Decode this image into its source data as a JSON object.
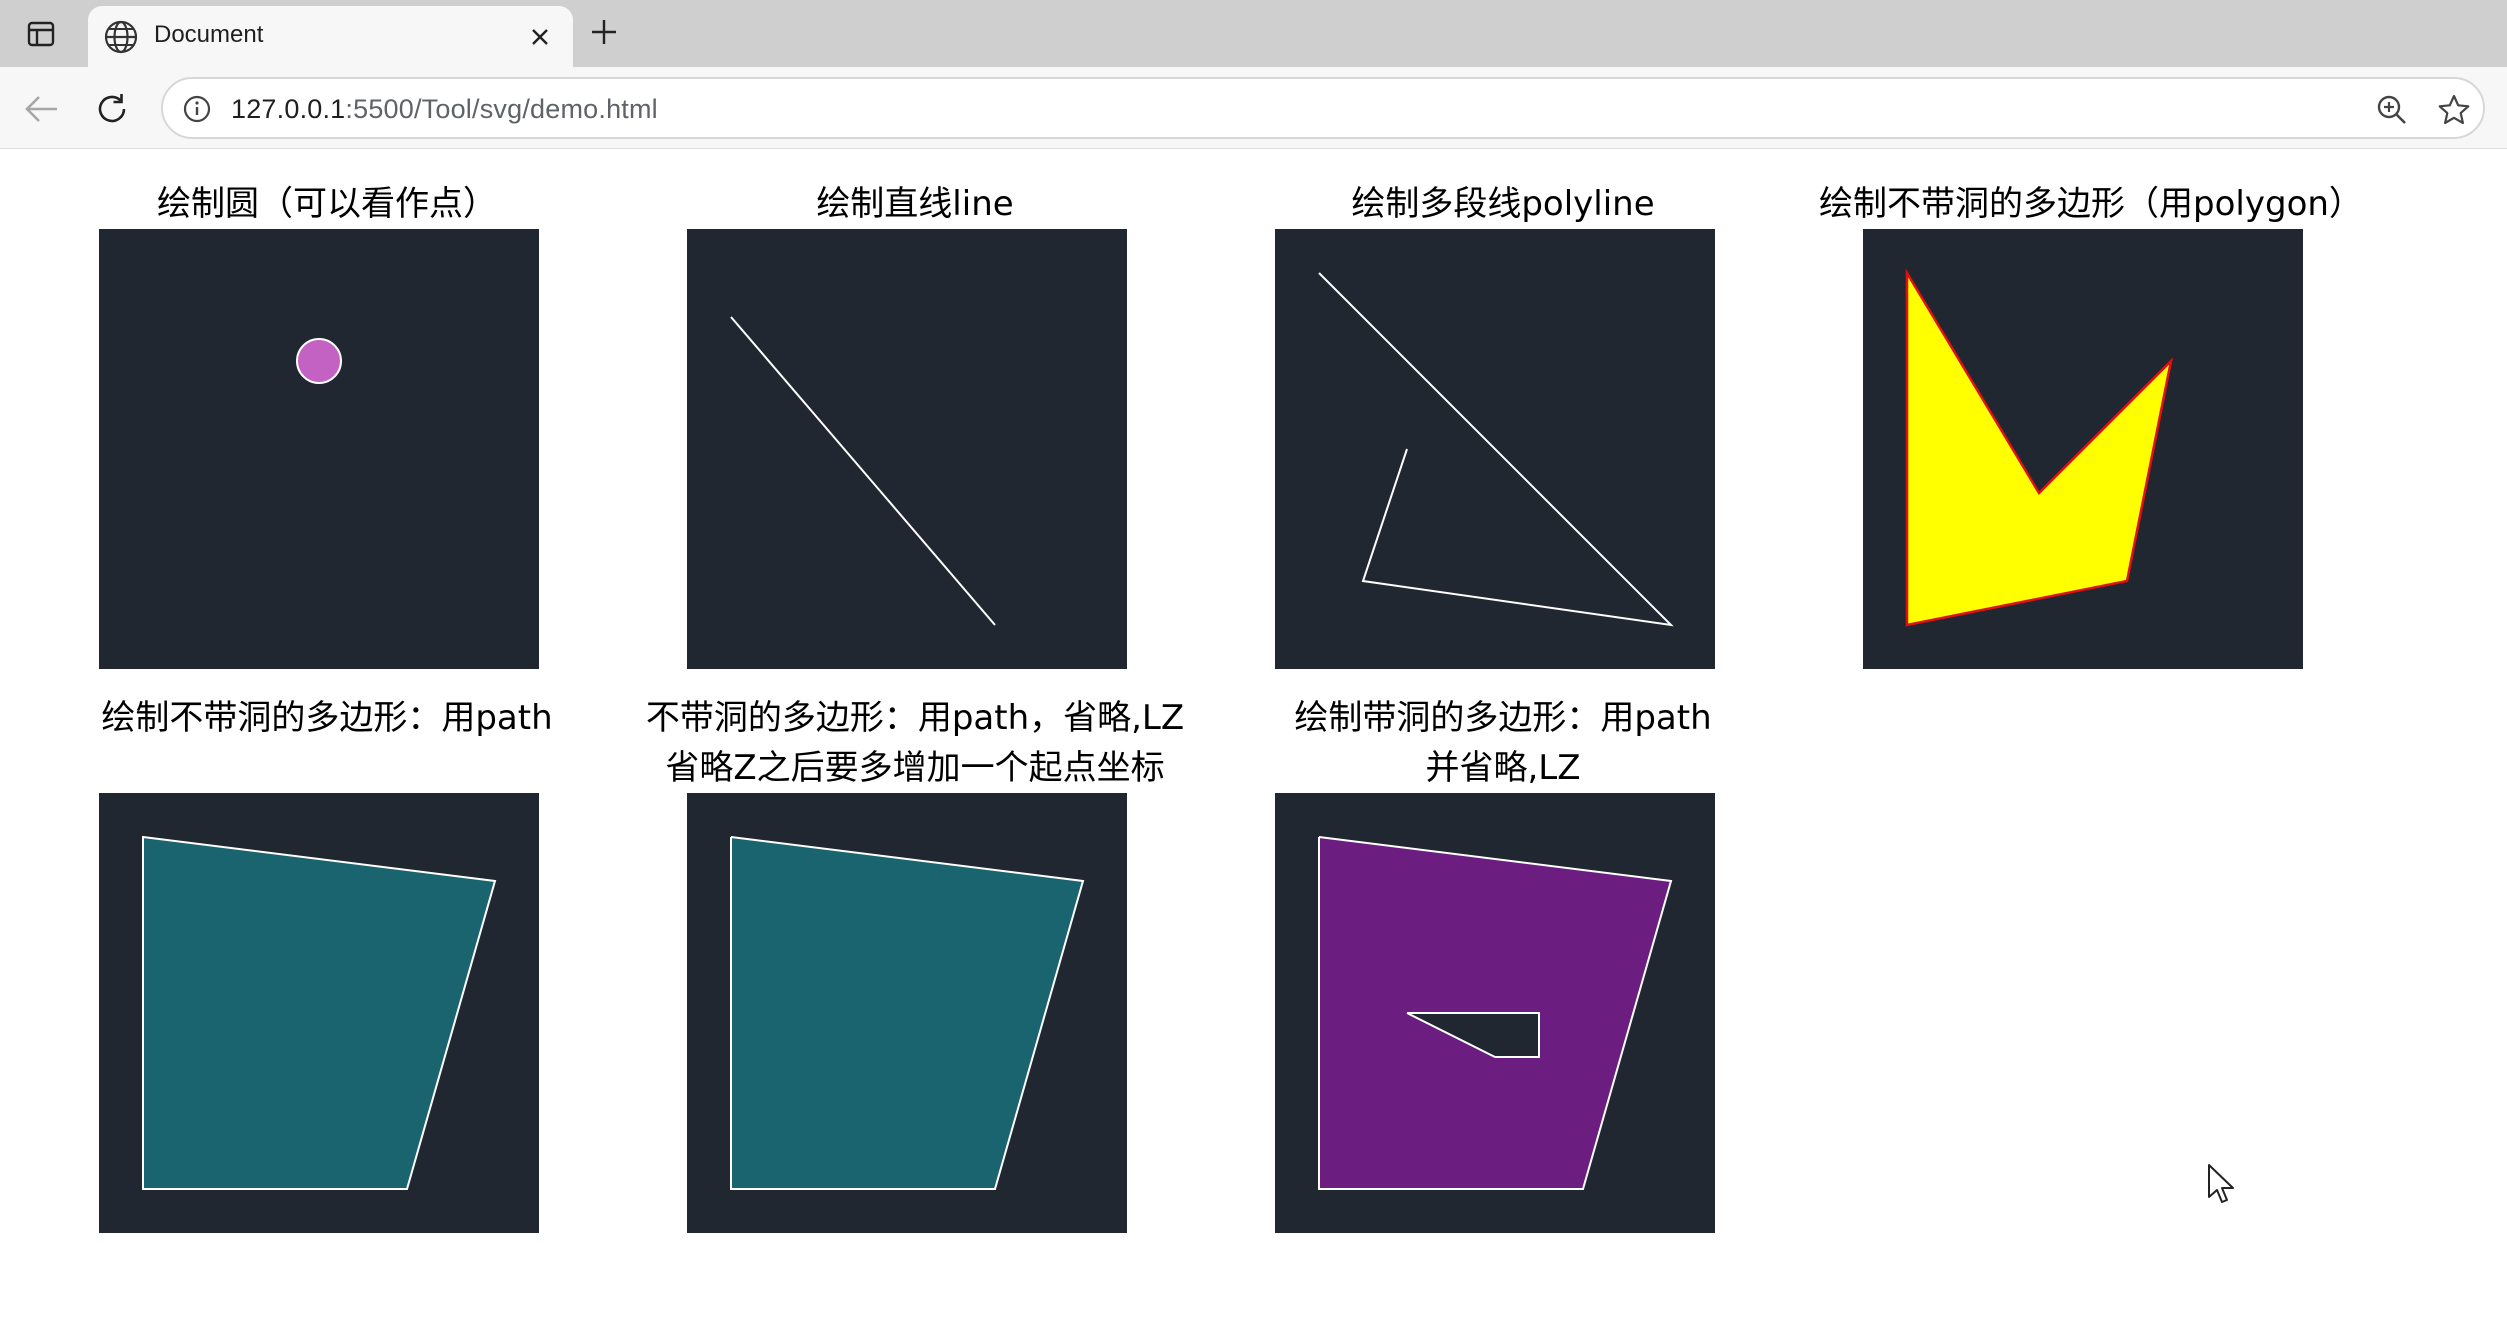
{
  "browser": {
    "tab": {
      "title": "Document"
    },
    "url": {
      "host": "127.0.0.1",
      "rest": ":5500/Tool/svg/demo.html"
    }
  },
  "page": {
    "demos": [
      {
        "id": "circle",
        "title": [
          "绘制圆（可以看作点）"
        ]
      },
      {
        "id": "line",
        "title": [
          "绘制直线line"
        ]
      },
      {
        "id": "polyline",
        "title": [
          "绘制多段线polyline"
        ]
      },
      {
        "id": "polygon",
        "title": [
          "绘制不带洞的多边形（用polygon）"
        ]
      },
      {
        "id": "path",
        "title": [
          "绘制不带洞的多边形：用path"
        ]
      },
      {
        "id": "path-lz",
        "title": [
          "不带洞的多边形：用path，省略,LZ",
          "省略Z之后要多增加一个起点坐标"
        ]
      },
      {
        "id": "path-hole",
        "title": [
          "绘制带洞的多边形：用path",
          "并省略,LZ"
        ]
      }
    ]
  },
  "colors": {
    "canvas_bg": "#212731",
    "circle_fill": "#c462c4",
    "stroke": "#ffffff",
    "polygon_fill": "#ffff00",
    "polygon_stroke": "#e01010",
    "path_fill": "#1a6470",
    "hole_fill": "#6b1d80"
  }
}
